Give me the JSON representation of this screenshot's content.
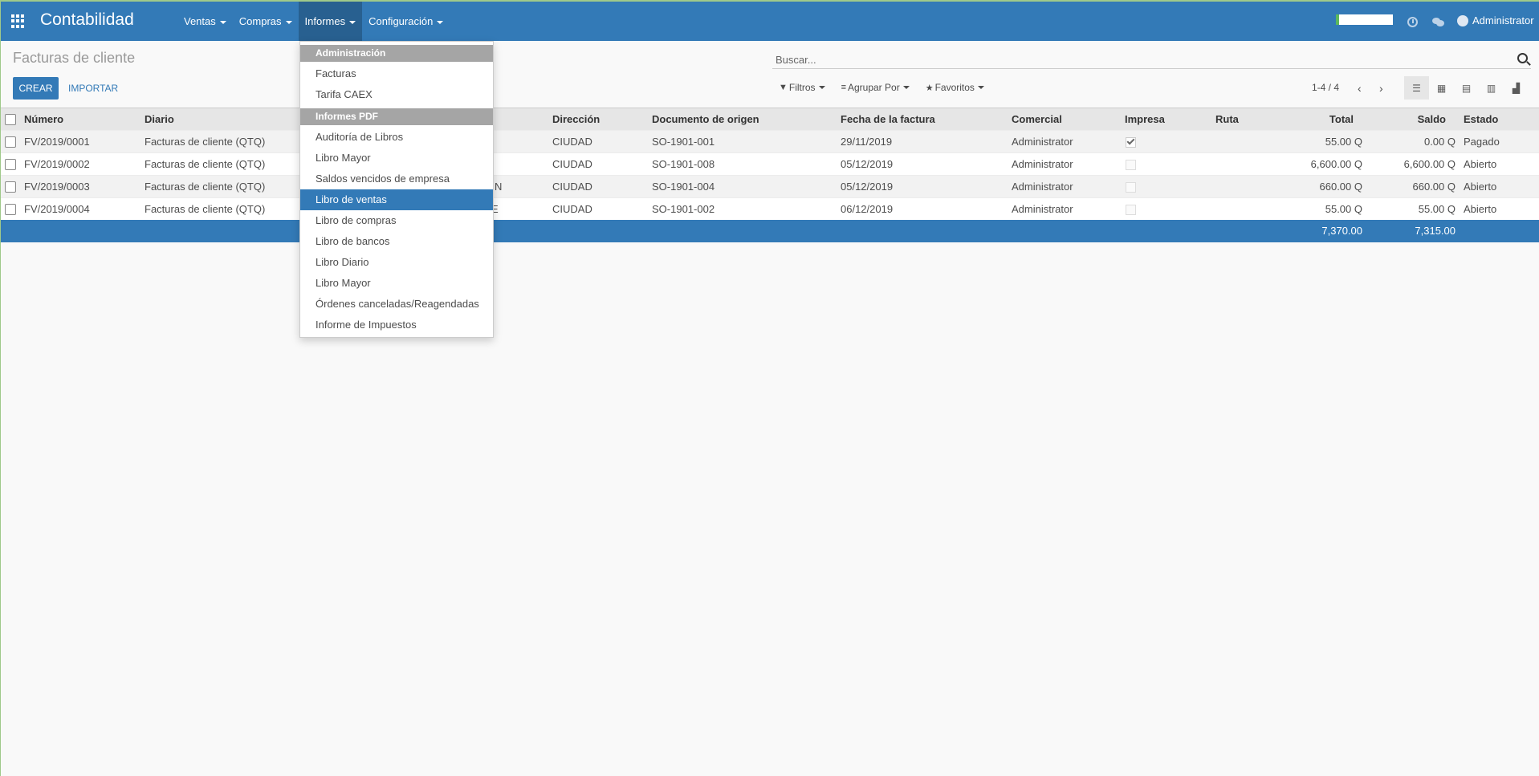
{
  "app": {
    "title": "Contabilidad"
  },
  "nav": {
    "items": [
      {
        "label": "Ventas"
      },
      {
        "label": "Compras"
      },
      {
        "label": "Informes"
      },
      {
        "label": "Configuración"
      }
    ],
    "user": "Administrator"
  },
  "control": {
    "page_title": "Facturas de cliente",
    "create_label": "CREAR",
    "import_label": "IMPORTAR",
    "search_placeholder": "Buscar...",
    "filters_label": "Filtros",
    "groupby_label": "Agrupar Por",
    "favorites_label": "Favoritos",
    "pager": "1-4 / 4",
    "active_view": "list"
  },
  "table": {
    "headers": {
      "numero": "Número",
      "diario": "Diario",
      "direccion": "Dirección",
      "documento": "Documento de origen",
      "fecha": "Fecha de la factura",
      "comercial": "Comercial",
      "impresa": "Impresa",
      "ruta": "Ruta",
      "total": "Total",
      "saldo": "Saldo",
      "estado": "Estado"
    },
    "rows": [
      {
        "numero": "FV/2019/0001",
        "diario": "Facturas de cliente (QTQ)",
        "hidden": "",
        "direccion": "CIUDAD",
        "documento": "SO-1901-001",
        "fecha": "29/11/2019",
        "comercial": "Administrator",
        "impresa": true,
        "total": "55.00 Q",
        "saldo": "0.00 Q",
        "estado": "Pagado"
      },
      {
        "numero": "FV/2019/0002",
        "diario": "Facturas de cliente (QTQ)",
        "hidden": "",
        "direccion": "CIUDAD",
        "documento": "SO-1901-008",
        "fecha": "05/12/2019",
        "comercial": "Administrator",
        "impresa": false,
        "total": "6,600.00 Q",
        "saldo": "6,600.00 Q",
        "estado": "Abierto"
      },
      {
        "numero": "FV/2019/0003",
        "diario": "Facturas de cliente (QTQ)",
        "hidden": "N",
        "direccion": "CIUDAD",
        "documento": "SO-1901-004",
        "fecha": "05/12/2019",
        "comercial": "Administrator",
        "impresa": false,
        "total": "660.00 Q",
        "saldo": "660.00 Q",
        "estado": "Abierto"
      },
      {
        "numero": "FV/2019/0004",
        "diario": "Facturas de cliente (QTQ)",
        "hidden": "E",
        "direccion": "CIUDAD",
        "documento": "SO-1901-002",
        "fecha": "06/12/2019",
        "comercial": "Administrator",
        "impresa": false,
        "total": "55.00 Q",
        "saldo": "55.00 Q",
        "estado": "Abierto"
      }
    ],
    "totals": {
      "total": "7,370.00",
      "saldo": "7,315.00"
    }
  },
  "dropdown": {
    "sections": [
      {
        "header": "Administración",
        "items": [
          "Facturas",
          "Tarifa CAEX"
        ]
      },
      {
        "header": "Informes PDF",
        "items": [
          "Auditoría de Libros",
          "Libro Mayor",
          "Saldos vencidos de empresa",
          "Libro de ventas",
          "Libro de compras",
          "Libro de bancos",
          "Libro Diario",
          "Libro Mayor",
          "Órdenes canceladas/Reagendadas",
          "Informe de Impuestos"
        ]
      }
    ],
    "active_item": "Libro de ventas"
  },
  "colors": {
    "primary": "#337ab7",
    "navbar_active": "#286090",
    "dropdown_header": "#a5a5a5"
  }
}
